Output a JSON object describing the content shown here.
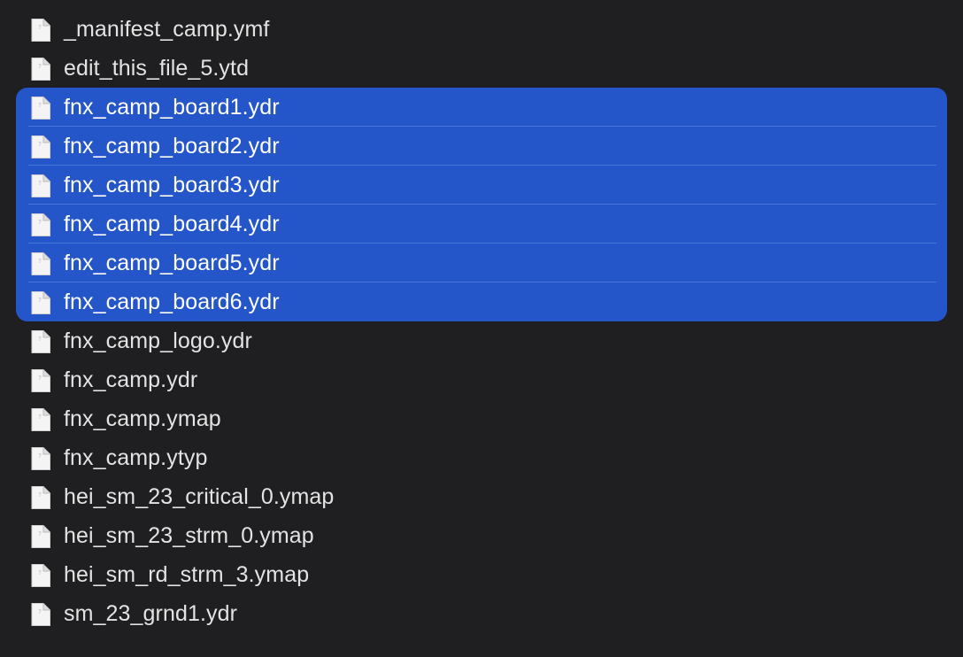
{
  "colors": {
    "background": "#1f1f21",
    "selection": "#2456c9",
    "text": "#e3e3e3",
    "selected_text": "#ffffff"
  },
  "files": [
    {
      "name": "_manifest_camp.ymf",
      "icon": "document-icon",
      "selected": false
    },
    {
      "name": "edit_this_file_5.ytd",
      "icon": "document-icon",
      "selected": false
    },
    {
      "name": "fnx_camp_board1.ydr",
      "icon": "document-icon",
      "selected": true
    },
    {
      "name": "fnx_camp_board2.ydr",
      "icon": "document-icon",
      "selected": true
    },
    {
      "name": "fnx_camp_board3.ydr",
      "icon": "document-icon",
      "selected": true
    },
    {
      "name": "fnx_camp_board4.ydr",
      "icon": "document-icon",
      "selected": true
    },
    {
      "name": "fnx_camp_board5.ydr",
      "icon": "document-icon",
      "selected": true
    },
    {
      "name": "fnx_camp_board6.ydr",
      "icon": "document-icon",
      "selected": true
    },
    {
      "name": "fnx_camp_logo.ydr",
      "icon": "document-icon",
      "selected": false
    },
    {
      "name": "fnx_camp.ydr",
      "icon": "document-icon",
      "selected": false
    },
    {
      "name": "fnx_camp.ymap",
      "icon": "document-icon",
      "selected": false
    },
    {
      "name": "fnx_camp.ytyp",
      "icon": "document-icon",
      "selected": false
    },
    {
      "name": "hei_sm_23_critical_0.ymap",
      "icon": "document-icon",
      "selected": false
    },
    {
      "name": "hei_sm_23_strm_0.ymap",
      "icon": "document-icon",
      "selected": false
    },
    {
      "name": "hei_sm_rd_strm_3.ymap",
      "icon": "document-icon",
      "selected": false
    },
    {
      "name": "sm_23_grnd1.ydr",
      "icon": "document-icon",
      "selected": false
    }
  ]
}
